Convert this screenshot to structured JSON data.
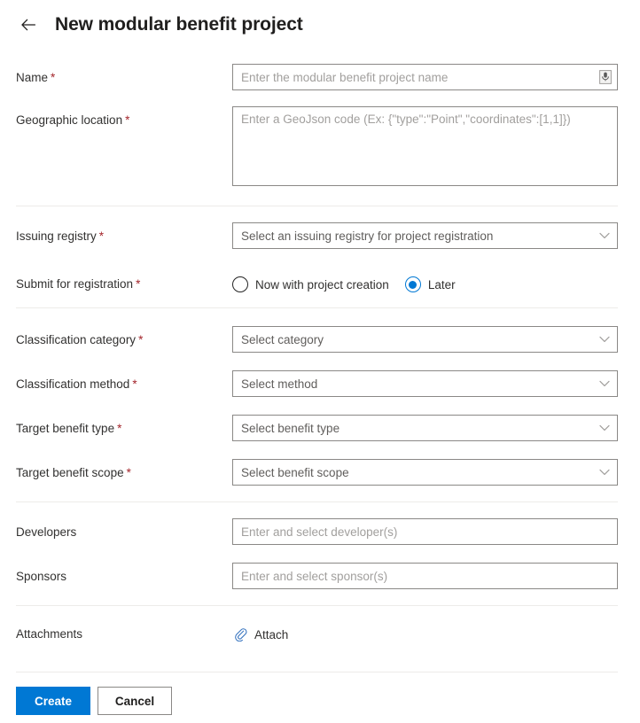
{
  "header": {
    "back_icon": "back-arrow-icon",
    "title": "New modular benefit project"
  },
  "form": {
    "required_marker": "*",
    "fields": {
      "name": {
        "label": "Name",
        "required": true,
        "value": "",
        "placeholder": "Enter the modular benefit project name",
        "suffix_icon": "dictation-icon"
      },
      "geographic_location": {
        "label": "Geographic location",
        "required": true,
        "value": "",
        "placeholder": "Enter a GeoJson code (Ex: {\"type\":\"Point\",\"coordinates\":[1,1]})"
      },
      "issuing_registry": {
        "label": "Issuing registry",
        "required": true,
        "selected": "Select an issuing registry for project registration",
        "caret_icon": "chevron-down-icon"
      },
      "submit_for_registration": {
        "label": "Submit for registration",
        "required": true,
        "options": [
          {
            "label": "Now with project creation",
            "selected": false
          },
          {
            "label": "Later",
            "selected": true
          }
        ]
      },
      "classification_category": {
        "label": "Classification category",
        "required": true,
        "selected": "Select category",
        "caret_icon": "chevron-down-icon"
      },
      "classification_method": {
        "label": "Classification method",
        "required": true,
        "selected": "Select method",
        "caret_icon": "chevron-down-icon"
      },
      "target_benefit_type": {
        "label": "Target benefit type",
        "required": true,
        "selected": "Select benefit type",
        "caret_icon": "chevron-down-icon"
      },
      "target_benefit_scope": {
        "label": "Target benefit scope",
        "required": true,
        "selected": "Select benefit scope",
        "caret_icon": "chevron-down-icon"
      },
      "developers": {
        "label": "Developers",
        "required": false,
        "value": "",
        "placeholder": "Enter and select developer(s)"
      },
      "sponsors": {
        "label": "Sponsors",
        "required": false,
        "value": "",
        "placeholder": "Enter and select sponsor(s)"
      },
      "attachments": {
        "label": "Attachments",
        "required": false,
        "attach_label": "Attach",
        "attach_icon": "paperclip-icon"
      }
    }
  },
  "footer": {
    "create_label": "Create",
    "cancel_label": "Cancel"
  },
  "colors": {
    "accent": "#0078d4",
    "required_asterisk": "#a4262c",
    "border": "#8a8886",
    "divider": "#edebe9",
    "placeholder": "#a19f9d",
    "text": "#323130"
  }
}
